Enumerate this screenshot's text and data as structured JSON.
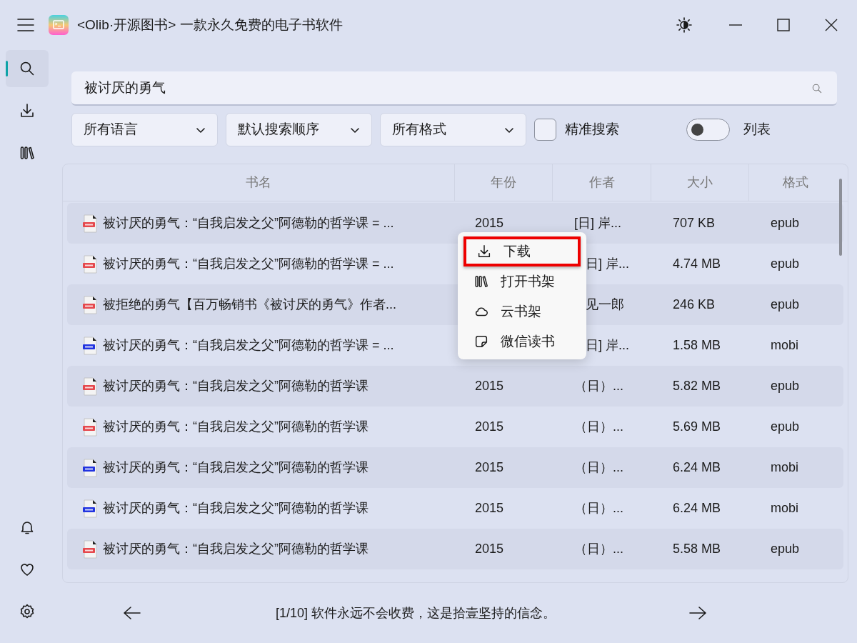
{
  "window": {
    "title": "<Olib·开源图书> 一款永久免费的电子书软件"
  },
  "sidebar": {
    "items": [
      {
        "selected": true
      },
      {
        "selected": false
      },
      {
        "selected": false
      }
    ]
  },
  "search": {
    "value": "被讨厌的勇气"
  },
  "filters": [
    {
      "label": "所有语言"
    },
    {
      "label": "默认搜索顺序"
    },
    {
      "label": "所有格式"
    }
  ],
  "exact_search": {
    "label": "精准搜索",
    "checked": false
  },
  "list_view": {
    "label": "列表",
    "on": false
  },
  "table": {
    "columns": [
      "书名",
      "年份",
      "作者",
      "大小",
      "格式"
    ],
    "rows": [
      {
        "kind": "epub",
        "title": "被讨厌的勇气：“自我启发之父”阿德勒的哲学课 = ...",
        "year": "2015",
        "author": "[日] 岸...",
        "size": "707 KB",
        "format": "epub"
      },
      {
        "kind": "epub",
        "title": "被讨厌的勇气：“自我启发之父”阿德勒的哲学课 = ...",
        "author": "日] 岸...",
        "size": "4.74 MB",
        "format": "epub"
      },
      {
        "kind": "epub",
        "title": "被拒绝的勇气【百万畅销书《被讨厌的勇气》作者...",
        "author": "见一郎",
        "size": "246 KB",
        "format": "epub"
      },
      {
        "kind": "mobi",
        "title": "被讨厌的勇气：“自我启发之父”阿德勒的哲学课 = ...",
        "author": "日] 岸...",
        "size": "1.58 MB",
        "format": "mobi"
      },
      {
        "kind": "epub",
        "title": "被讨厌的勇气：“自我启发之父”阿德勒的哲学课",
        "year": "2015",
        "author": "（日）...",
        "size": "5.82 MB",
        "format": "epub"
      },
      {
        "kind": "epub",
        "title": "被讨厌的勇气：“自我启发之父”阿德勒的哲学课",
        "year": "2015",
        "author": "（日）...",
        "size": "5.69 MB",
        "format": "epub"
      },
      {
        "kind": "mobi",
        "title": "被讨厌的勇气：“自我启发之父”阿德勒的哲学课",
        "year": "2015",
        "author": "（日）...",
        "size": "6.24 MB",
        "format": "mobi"
      },
      {
        "kind": "mobi",
        "title": "被讨厌的勇气：“自我启发之父”阿德勒的哲学课",
        "year": "2015",
        "author": "（日）...",
        "size": "6.24 MB",
        "format": "mobi"
      },
      {
        "kind": "epub",
        "title": "被讨厌的勇气：“自我启发之父”阿德勒的哲学课",
        "year": "2015",
        "author": "（日）...",
        "size": "5.58 MB",
        "format": "epub"
      }
    ]
  },
  "context_menu": {
    "items": [
      {
        "label": "下载",
        "selected": true
      },
      {
        "label": "打开书架",
        "selected": false
      },
      {
        "label": "云书架",
        "selected": false
      },
      {
        "label": "微信读书",
        "selected": false
      }
    ]
  },
  "footer": {
    "message": "[1/10] 软件永远不会收费，这是拾壹坚持的信念。"
  }
}
